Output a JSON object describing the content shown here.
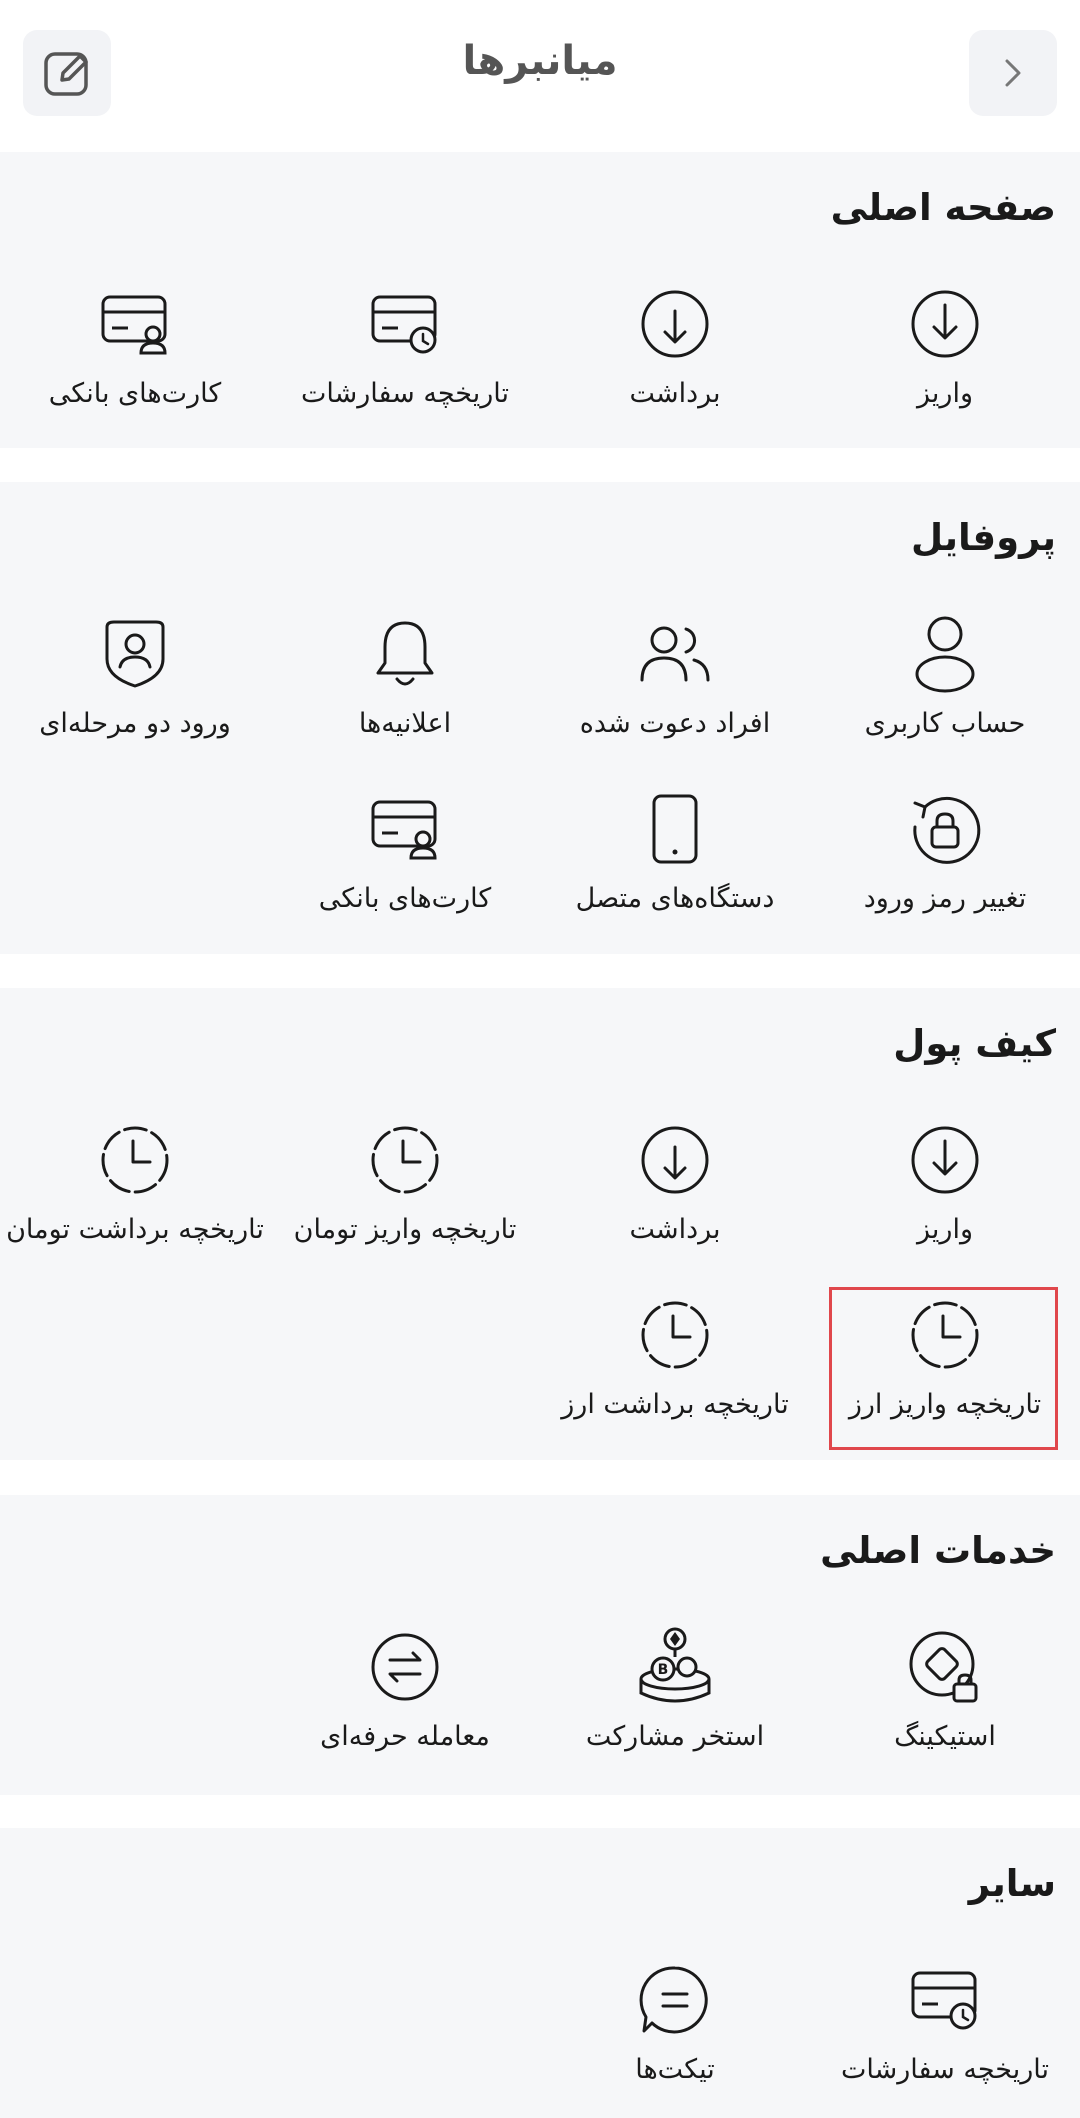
{
  "header": {
    "title": "میانبرها"
  },
  "sections": {
    "main": {
      "title": "صفحه اصلی",
      "items": [
        "واریز",
        "برداشت",
        "تاریخچه سفارشات",
        "کارت‌های بانکی"
      ]
    },
    "profile": {
      "title": "پروفایل",
      "items": [
        "حساب کاربری",
        "افراد دعوت شده",
        "اعلانیه‌ها",
        "ورود دو مرحله‌ای",
        "تغییر رمز ورود",
        "دستگاه‌های متصل",
        "کارت‌های بانکی"
      ]
    },
    "wallet": {
      "title": "کیف پول",
      "items": [
        "واریز",
        "برداشت",
        "تاریخچه واریز تومان",
        "تاریخچه برداشت تومان",
        "تاریخچه واریز ارز",
        "تاریخچه برداشت ارز"
      ]
    },
    "services": {
      "title": "خدمات اصلی",
      "items": [
        "استیکینگ",
        "استخر مشارکت",
        "معامله حرفه‌ای"
      ]
    },
    "other": {
      "title": "سایر",
      "items": [
        "تاریخچه سفارشات",
        "تیکت‌ها"
      ]
    }
  }
}
